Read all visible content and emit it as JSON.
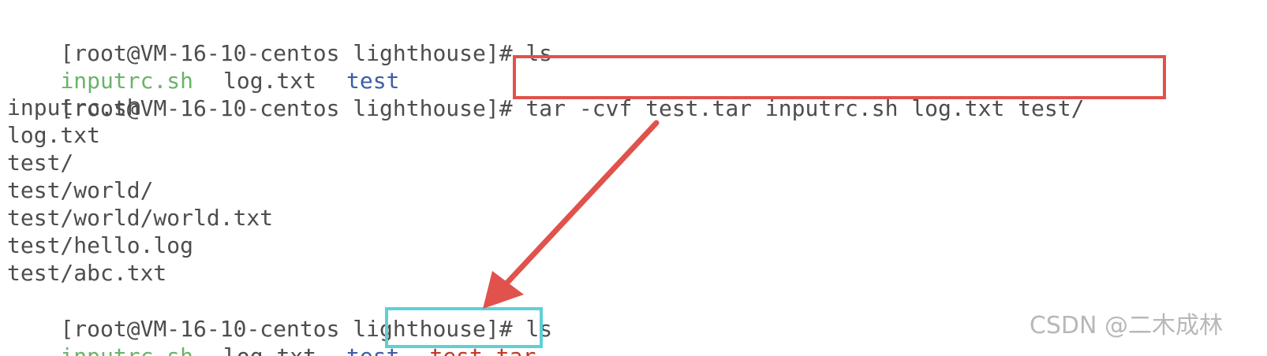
{
  "terminal": {
    "line1": {
      "prompt": "[root@VM-16-10-centos lighthouse]#",
      "command": " ls"
    },
    "line2": {
      "items": [
        "inputrc.sh",
        "log.txt",
        "test"
      ]
    },
    "line3": {
      "prompt": "[root@VM-16-10-centos lighthouse]#",
      "command": " tar -cvf test.tar inputrc.sh log.txt test/"
    },
    "output": [
      "inputrc.sh",
      "log.txt",
      "test/",
      "test/world/",
      "test/world/world.txt",
      "test/hello.log",
      "test/abc.txt"
    ],
    "line11": {
      "prompt": "[root@VM-16-10-centos lighthouse]#",
      "command": " ls"
    },
    "line12": {
      "items": [
        "inputrc.sh",
        "log.txt",
        "test",
        "test.tar"
      ]
    }
  },
  "colors": {
    "executable": "#6bb36b",
    "directory": "#3c5ea8",
    "archive": "#c0392b",
    "highlight_command": "#e0524b",
    "highlight_result": "#5ed0d6",
    "arrow": "#e0524b"
  },
  "watermark": "CSDN @二木成林"
}
